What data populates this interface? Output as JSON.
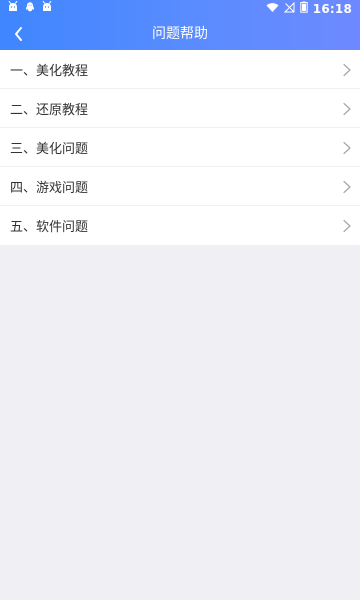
{
  "status_bar": {
    "time": "16:18",
    "left_icons": [
      "android-notification-icon",
      "qq-notification-icon",
      "android-notification-icon"
    ],
    "right_icons": [
      "wifi-icon",
      "signal-off-icon",
      "battery-icon"
    ]
  },
  "header": {
    "title": "问题帮助",
    "back_icon": "chevron-left-icon",
    "gradient_start": "#3f86ff",
    "gradient_end": "#6e89ff"
  },
  "menu": {
    "items": [
      {
        "label": "一、美化教程",
        "icon": "chevron-right-icon"
      },
      {
        "label": "二、还原教程",
        "icon": "chevron-right-icon"
      },
      {
        "label": "三、美化问题",
        "icon": "chevron-right-icon"
      },
      {
        "label": "四、游戏问题",
        "icon": "chevron-right-icon"
      },
      {
        "label": "五、软件问题",
        "icon": "chevron-right-icon"
      }
    ]
  },
  "colors": {
    "page_background": "#efeff4",
    "list_background": "#ffffff",
    "text": "#333333",
    "divider": "#f0f0f0",
    "chevron": "#a6a6a6"
  }
}
